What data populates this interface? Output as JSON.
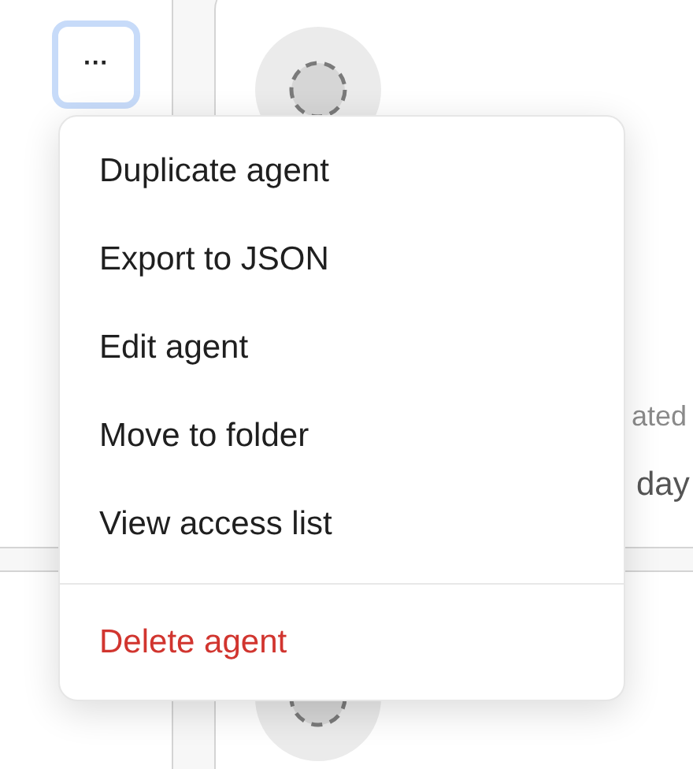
{
  "more_button": {
    "label": "···",
    "focused": true
  },
  "agent_card": {
    "created_label": "ated",
    "created_value": "day"
  },
  "menu": {
    "items": [
      {
        "label": "Duplicate agent",
        "kind": "normal"
      },
      {
        "label": "Export to JSON",
        "kind": "normal"
      },
      {
        "label": "Edit agent",
        "kind": "normal"
      },
      {
        "label": "Move to folder",
        "kind": "normal"
      },
      {
        "label": "View access list",
        "kind": "normal"
      },
      {
        "label": "Delete agent",
        "kind": "danger"
      }
    ]
  }
}
